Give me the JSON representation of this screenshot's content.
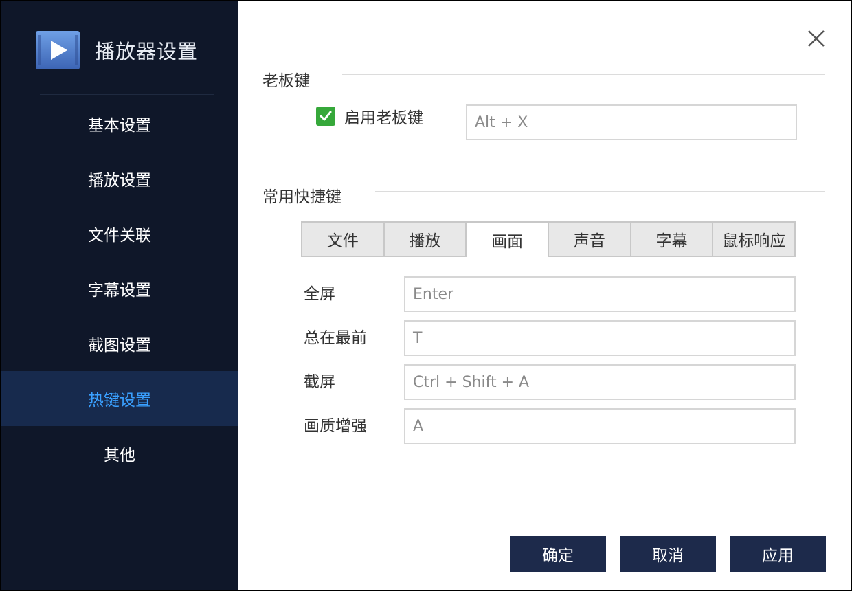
{
  "app": {
    "title": "播放器设置",
    "logo_icon": "video-player-logo-icon",
    "accent_color": "#3aa0ff",
    "sidebar_bg": "#0f1729",
    "button_bg": "#1d2a4b",
    "checkbox_color": "#36a83a"
  },
  "sidebar": {
    "items": [
      {
        "label": "基本设置",
        "active": false
      },
      {
        "label": "播放设置",
        "active": false
      },
      {
        "label": "文件关联",
        "active": false
      },
      {
        "label": "字幕设置",
        "active": false
      },
      {
        "label": "截图设置",
        "active": false
      },
      {
        "label": "热键设置",
        "active": true
      },
      {
        "label": "其他",
        "active": false
      }
    ]
  },
  "close_icon": "close-icon",
  "boss_key": {
    "section_title": "老板键",
    "checkbox_label": "启用老板键",
    "checked": true,
    "value": "Alt + X"
  },
  "shortcuts": {
    "section_title": "常用快捷键",
    "tabs": [
      {
        "label": "文件",
        "active": false
      },
      {
        "label": "播放",
        "active": false
      },
      {
        "label": "画面",
        "active": true
      },
      {
        "label": "声音",
        "active": false
      },
      {
        "label": "字幕",
        "active": false
      },
      {
        "label": "鼠标响应",
        "active": false
      }
    ],
    "rows": [
      {
        "label": "全屏",
        "value": "Enter"
      },
      {
        "label": "总在最前",
        "value": "T"
      },
      {
        "label": "截屏",
        "value": "Ctrl + Shift + A"
      },
      {
        "label": "画质增强",
        "value": "A"
      }
    ]
  },
  "footer": {
    "ok_label": "确定",
    "cancel_label": "取消",
    "apply_label": "应用"
  }
}
